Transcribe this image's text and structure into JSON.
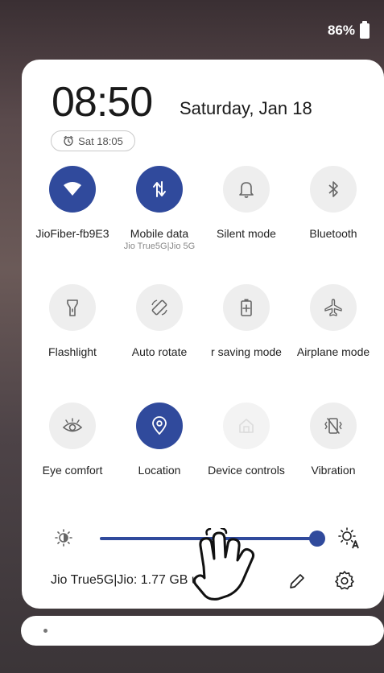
{
  "status": {
    "battery": "86%"
  },
  "header": {
    "time": "08:50",
    "date": "Saturday, Jan 18",
    "alarm": "Sat 18:05"
  },
  "tiles": [
    {
      "label": "JioFiber-fb9E3",
      "active": true,
      "icon": "wifi-icon"
    },
    {
      "label": "Mobile data",
      "sublabel": "Jio True5G|Jio 5G",
      "active": true,
      "icon": "mobile-data-icon"
    },
    {
      "label": "Silent mode",
      "active": false,
      "icon": "bell-icon"
    },
    {
      "label": "Bluetooth",
      "active": false,
      "icon": "bluetooth-icon"
    },
    {
      "label": "Flashlight",
      "active": false,
      "icon": "flashlight-icon"
    },
    {
      "label": "Auto rotate",
      "active": false,
      "icon": "rotate-icon"
    },
    {
      "label": "r saving mode",
      "active": false,
      "icon": "battery-saver-icon"
    },
    {
      "label": "Airplane mode",
      "active": false,
      "icon": "airplane-icon"
    },
    {
      "label": "Eye comfort",
      "active": false,
      "icon": "eye-icon"
    },
    {
      "label": "Location",
      "active": true,
      "icon": "location-icon"
    },
    {
      "label": "Device controls",
      "active": false,
      "icon": "home-icon"
    },
    {
      "label": "Vibration",
      "active": false,
      "icon": "vibration-icon"
    }
  ],
  "brightness": {
    "level": 1.0
  },
  "footer": {
    "data_usage": "Jio True5G|Jio: 1.77 GB used"
  },
  "colors": {
    "accent": "#304a9c"
  }
}
